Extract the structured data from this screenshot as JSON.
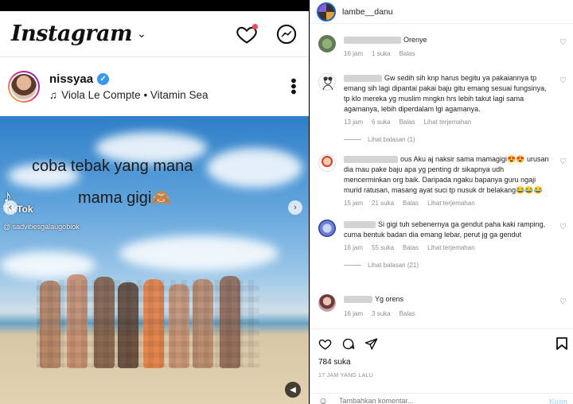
{
  "left": {
    "header": {
      "logo": "Instagram",
      "icons": [
        "chevron-down-icon",
        "heart-icon",
        "messenger-icon"
      ]
    },
    "post": {
      "username": "nissyaa",
      "audio": "Viola Le Compte • Vitamin Sea",
      "overlay_line1": "coba tebak yang mana",
      "overlay_line2": "mama gigi🙈",
      "tiktok_label": "TikTok",
      "tiktok_handle": "@ sadvibesgalaugobiok"
    }
  },
  "right": {
    "username": "lambe__danu",
    "comments": [
      {
        "text": "Orenye",
        "time": "16 jam",
        "likes": "1 suka",
        "reply": "Balas"
      },
      {
        "text": "Gw sedih sih knp harus begitu ya pakaiannya tp emang sih lagi dipantai pakai baju gitu emang sesuai fungsinya, tp klo mereka yg muslim mngkn hrs lebih takut lagi sama agamanya, lebih diperdalam lgi agamanya.",
        "time": "13 jam",
        "likes": "6 suka",
        "reply": "Balas",
        "translate": "Lihat terjemahan",
        "replies": "Lihat balasan (1)"
      },
      {
        "text": "ous Aku aj naksir sama mamagigi😍😍 urusan dia mau pake baju apa yg penting dr sikapnya udh mencerminkan org baik. Daripada ngaku bapanya guru ngaji murid ratusan, masang ayat suci tp nusuk dr belakang😂😂😂",
        "time": "15 jam",
        "likes": "21 suka",
        "reply": "Balas",
        "translate": "Lihat terjemahan"
      },
      {
        "text": "Si gigi tuh sebenernya ga gendut paha kaki ramping, cuma bentuk badan dia emang lebar, perut jg ga gendut",
        "time": "16 jam",
        "likes": "55 suka",
        "reply": "Balas",
        "translate": "Lihat terjemahan",
        "replies": "Lihat balasan (21)"
      },
      {
        "text": "Yg orens",
        "time": "16 jam",
        "likes": "3 suka",
        "reply": "Balas"
      }
    ],
    "likes_total": "784 suka",
    "posted_ago": "17 JAM YANG LALU",
    "comment_placeholder": "Tambahkan komentar...",
    "post_button": "Kirim"
  }
}
